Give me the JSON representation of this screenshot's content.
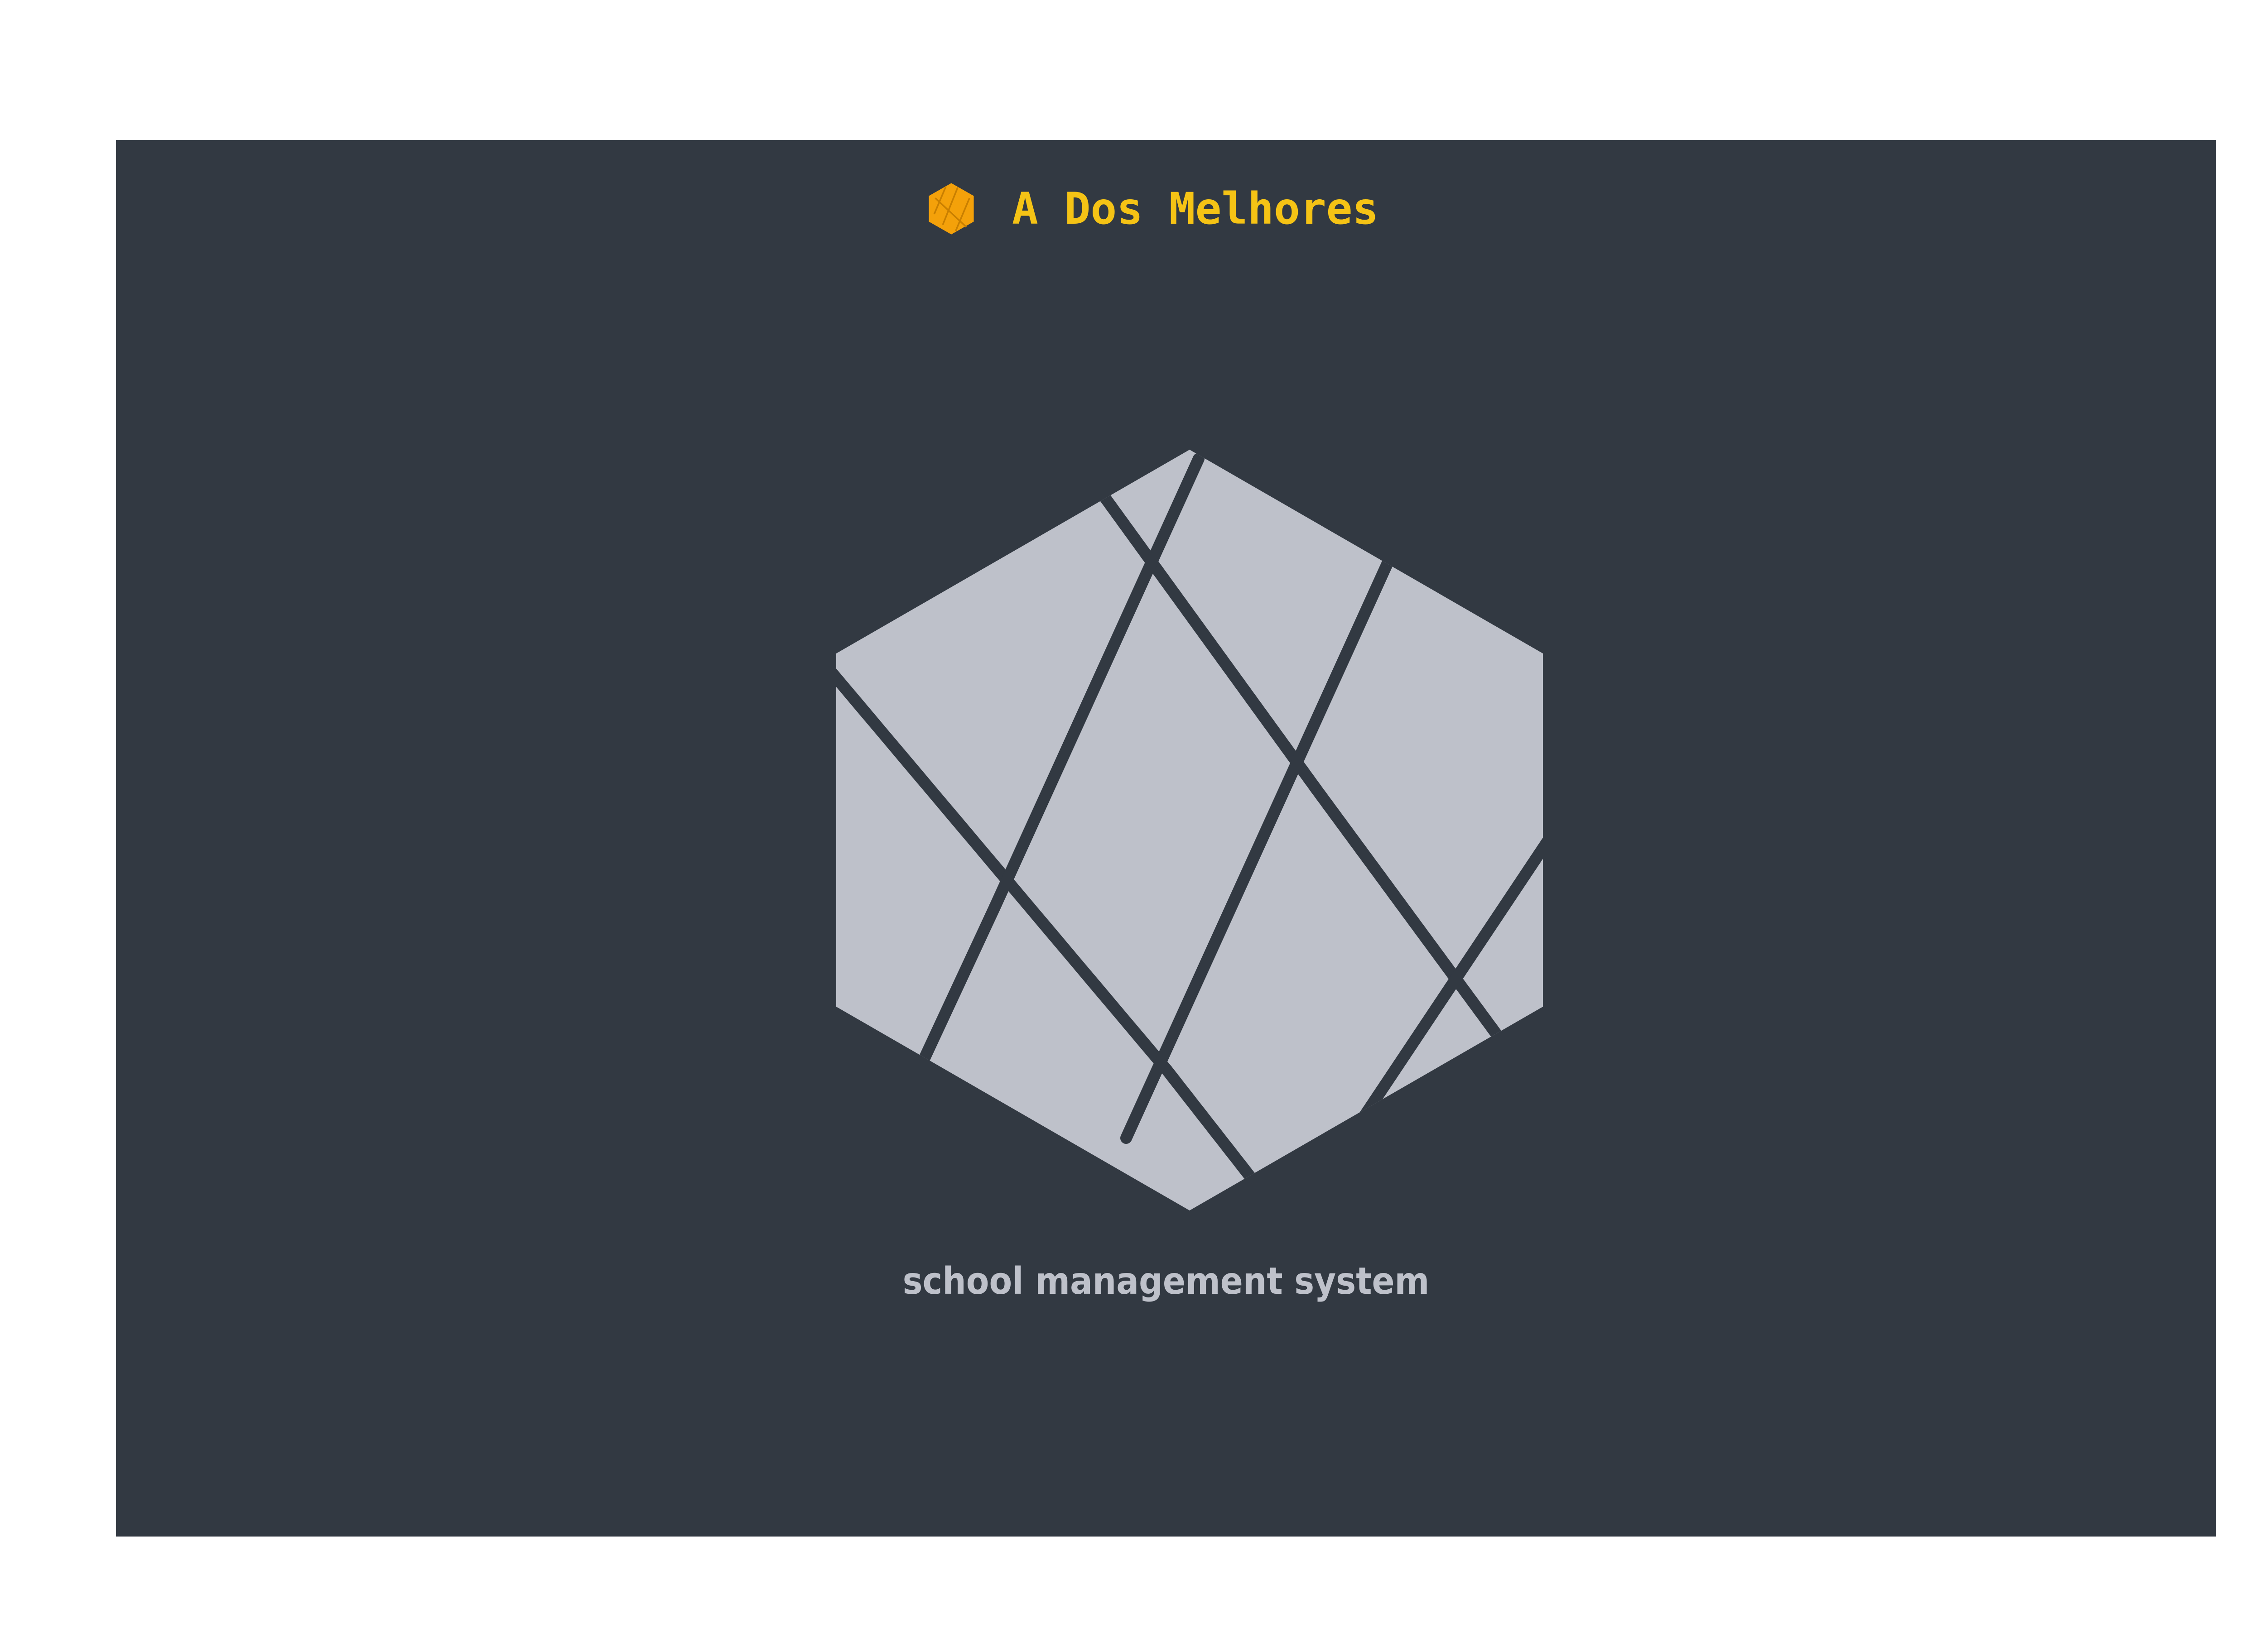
{
  "header": {
    "app_name": "A Dos Melhores",
    "logo_icon": "hexagon-logo-icon"
  },
  "hero": {
    "logo_icon": "hexagon-facets-logo",
    "tagline": "school management system"
  },
  "colors": {
    "background": "#ffffff",
    "panel": "#323942",
    "brand_text": "#f5c315",
    "brand_icon": "#f4a10a",
    "logo_fill": "#bec1ca",
    "tagline": "#bec1ca"
  }
}
